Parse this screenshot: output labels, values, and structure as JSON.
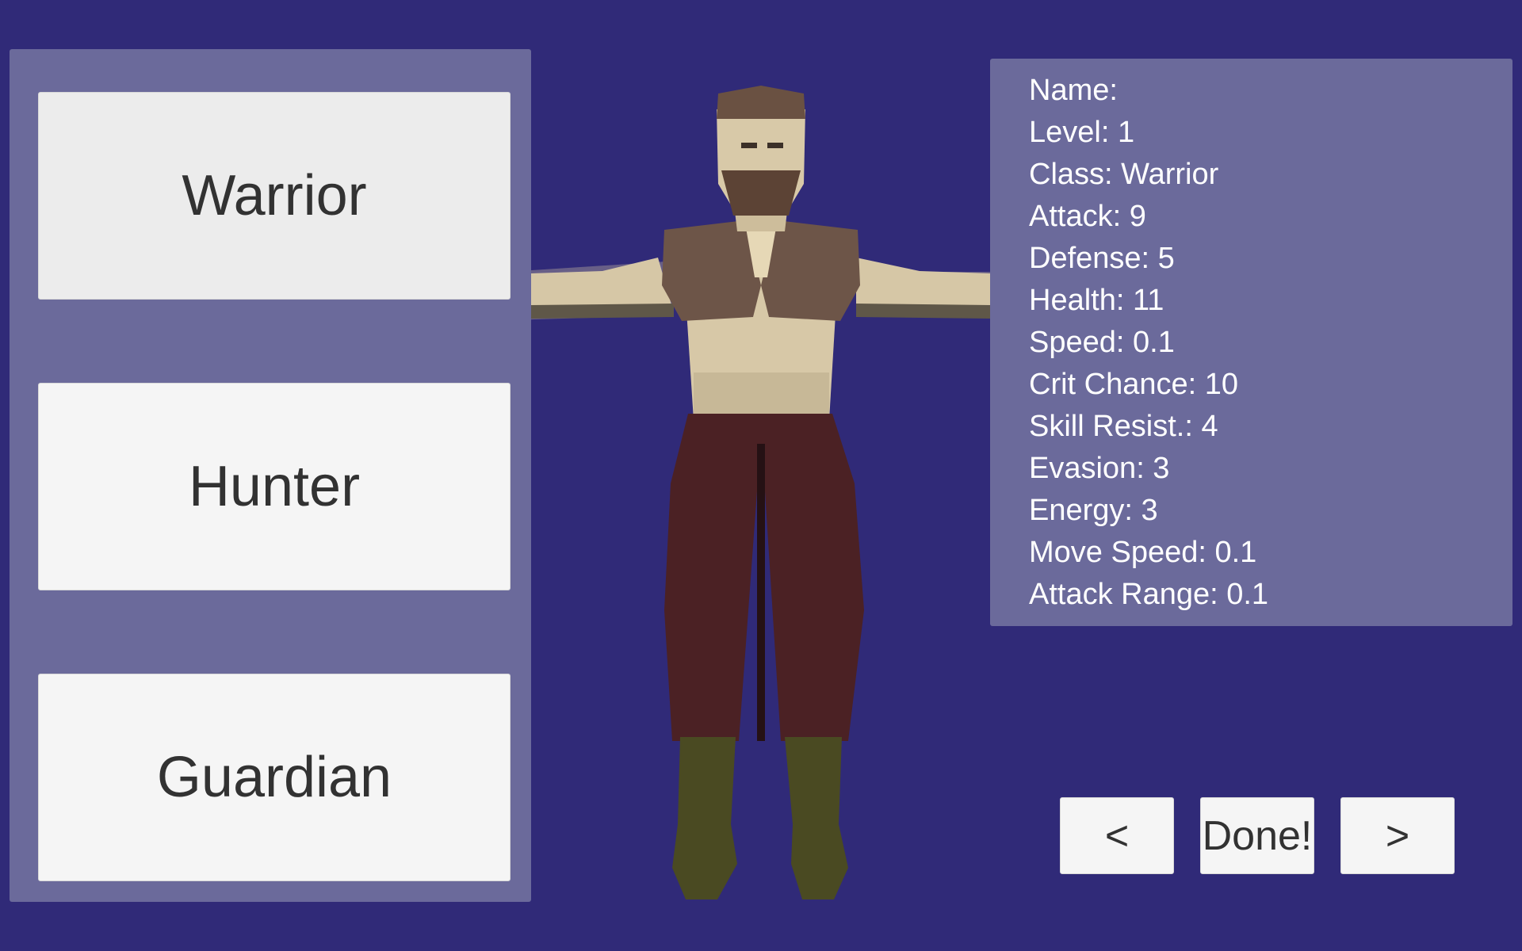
{
  "class_buttons": {
    "warrior": "Warrior",
    "hunter": "Hunter",
    "guardian": "Guardian"
  },
  "stats": {
    "name": "Name:",
    "level": "Level: 1",
    "class": "Class: Warrior",
    "attack": "Attack: 9",
    "defense": "Defense: 5",
    "health": "Health: 11",
    "speed": "Speed: 0.1",
    "crit_chance": "Crit Chance: 10",
    "skill_resist": "Skill Resist.: 4",
    "evasion": "Evasion: 3",
    "energy": "Energy: 3",
    "move_speed": "Move Speed: 0.1",
    "attack_range": "Attack Range: 0.1"
  },
  "nav": {
    "prev": "<",
    "done": "Done!",
    "next": ">"
  },
  "colors": {
    "background": "#302a78",
    "panel": "#6b6a9b",
    "button": "#f5f5f5",
    "button_text": "#323232",
    "stat_text": "#ffffff"
  }
}
